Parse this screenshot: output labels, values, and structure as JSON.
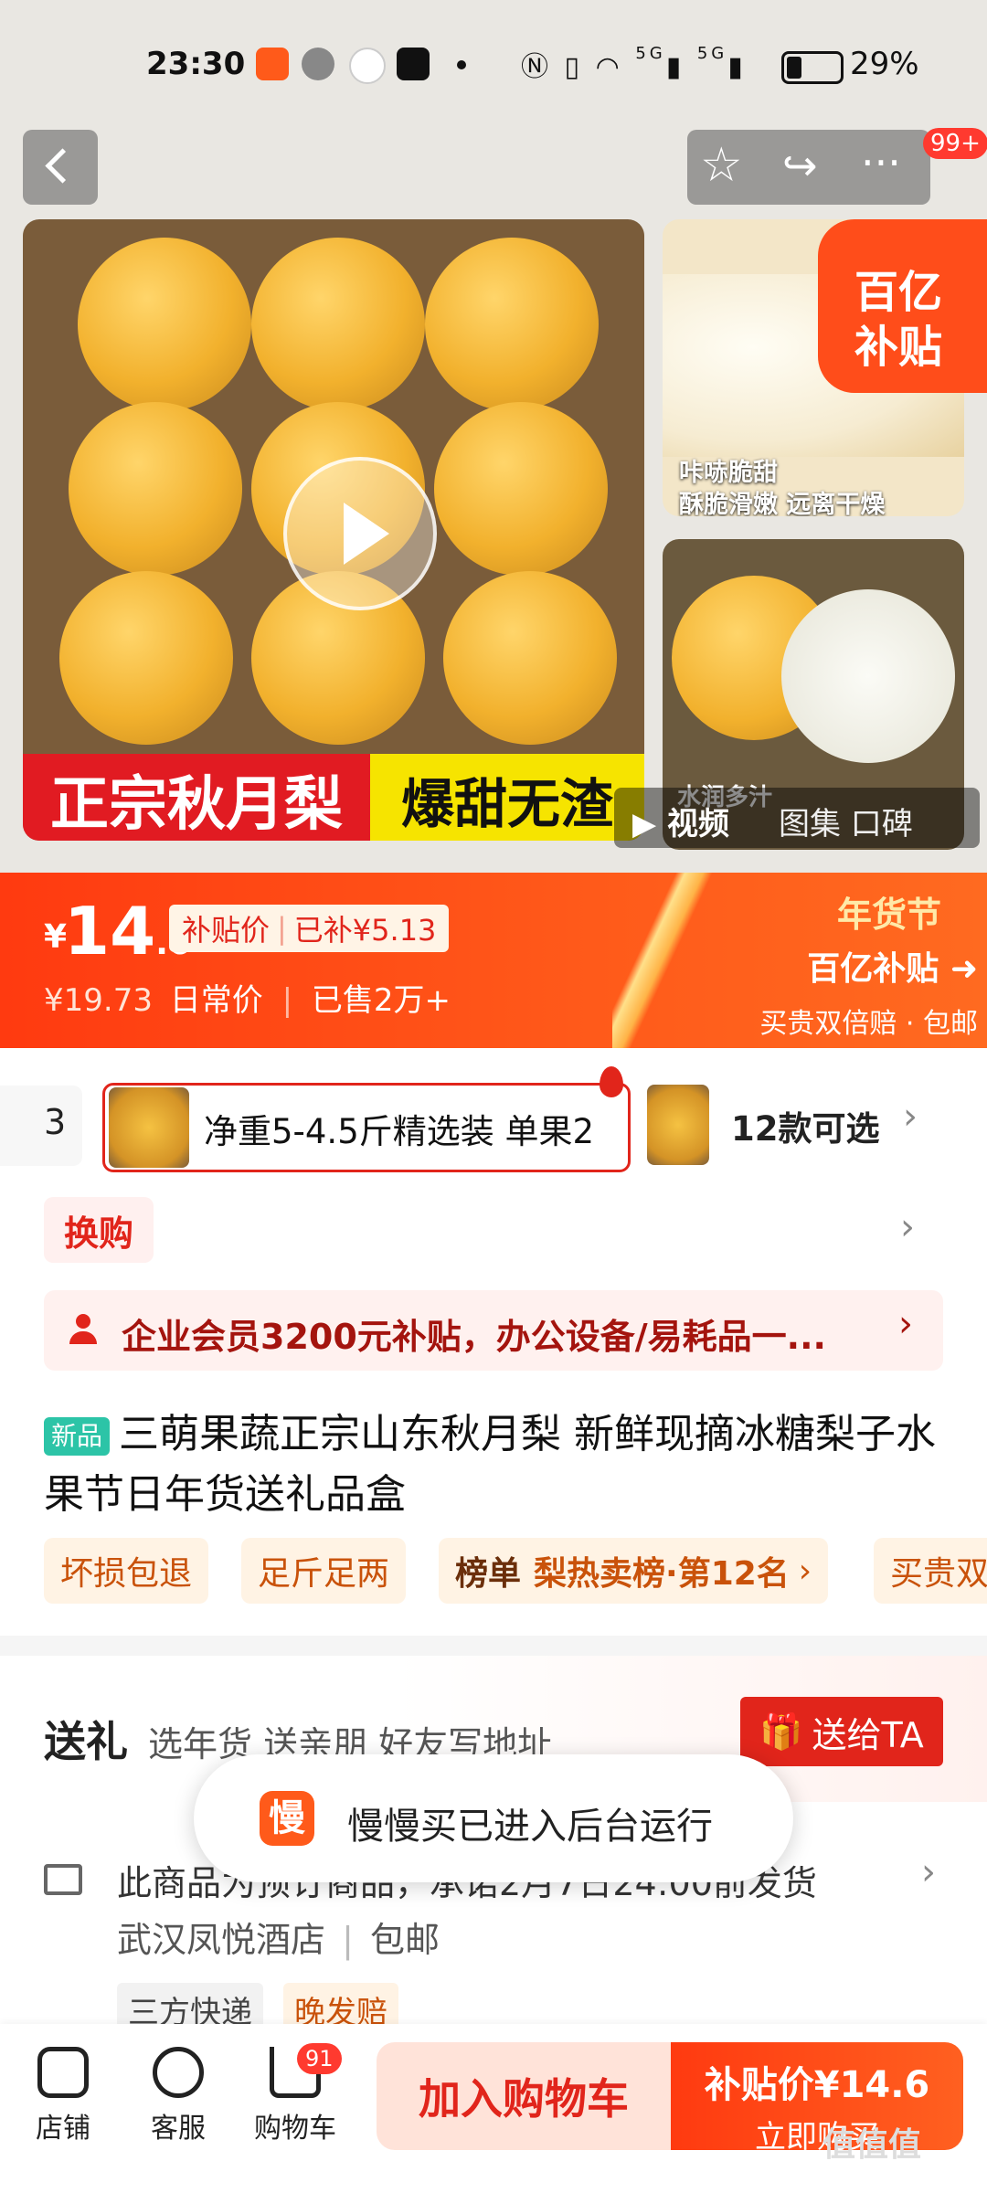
{
  "status_bar": {
    "time": "23:30",
    "battery_percent": "29%",
    "signal_labels": [
      "5G",
      "5G"
    ],
    "icons": [
      "slow-buy-app-icon",
      "wechat-icon",
      "realme-icon",
      "tiktok-icon",
      "nfc-icon",
      "vibrate-icon",
      "wifi-icon",
      "signal-icon",
      "battery-icon"
    ]
  },
  "header": {
    "back_icon": "back-icon",
    "favorite_icon": "star-icon",
    "share_icon": "share-icon",
    "more_icon": "more-icon",
    "more_badge": "99+"
  },
  "gallery": {
    "banner_left": "正宗秋月梨",
    "banner_right": "爆甜无渣",
    "side_top_caption_1": "咔哧脆甜",
    "side_top_caption_2": "酥脆滑嫩 远离干燥",
    "side_bottom_caption": "水润多汁",
    "subsidy_tag_line1": "百亿",
    "subsidy_tag_line2": "补贴",
    "video_label": "视频",
    "tabs_label": "图集 口碑"
  },
  "price": {
    "currency": "¥",
    "integer": "14",
    "decimal": ".6",
    "subsidy_label": "补贴价",
    "subsidy_amount": "已补¥5.13",
    "original_price": "¥19.73",
    "original_label": "日常价",
    "sold": "已售2万+",
    "festival_line1": "年货节",
    "festival_line2": "百亿补贴",
    "festival_line3": "买贵双倍赔 · 包邮"
  },
  "sku": {
    "prev_fragment": "3",
    "selected_label": "净重5-4.5斤精选装 单果2",
    "more_label": "12款可选"
  },
  "exchange": {
    "label": "换购"
  },
  "enterprise": {
    "text": "企业会员3200元补贴，办公设备/易耗品一..."
  },
  "product": {
    "new_tag": "新品",
    "title": "三萌果蔬正宗山东秋月梨 新鲜现摘冰糖梨子水果节日年货送礼品盒",
    "chips": [
      "坏损包退",
      "足斤足两"
    ],
    "rank_label": "榜单",
    "rank_text": "梨热卖榜·第12名",
    "chip_fragment": "买贵双"
  },
  "gift": {
    "title": "送礼",
    "subtitle": "选年货 送亲朋 好友写地址",
    "button": "送给TA"
  },
  "toast": {
    "icon_text": "慢",
    "text": "慢慢买已进入后台运行"
  },
  "shipping": {
    "line": "此商品为预订商品，承诺2月7日24:00前发货",
    "store": "武汉凤悦酒店",
    "free_shipping": "包邮",
    "tags": [
      "三方快递",
      "晚发赔"
    ]
  },
  "bottom_bar": {
    "shop_label": "店铺",
    "service_label": "客服",
    "cart_label": "购物车",
    "cart_badge": "91",
    "add_cart_label": "加入购物车",
    "buy_price_label": "补贴价¥14.6",
    "buy_now_label": "立即购买"
  },
  "watermark": "值值值",
  "colors": {
    "accent": "#e1251b",
    "orange": "#ff5a1a",
    "chip_bg": "#fff3e4",
    "new_tag": "#2cc4a7"
  }
}
